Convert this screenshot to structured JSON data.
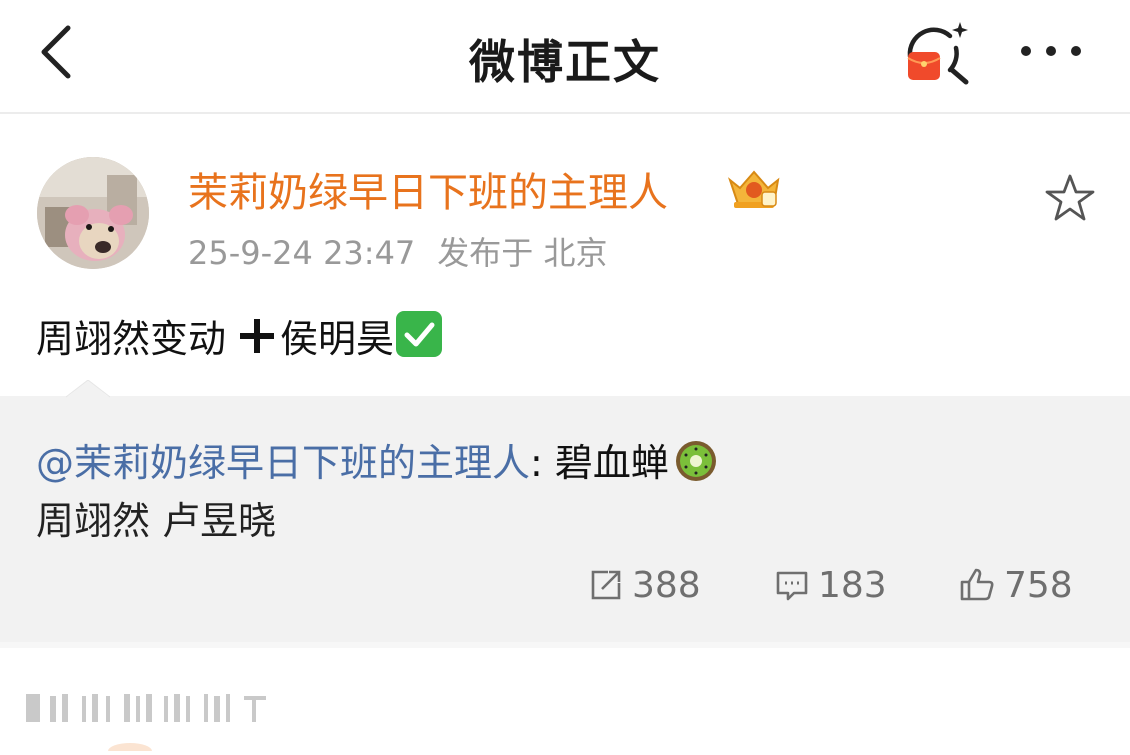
{
  "header": {
    "title": "微博正文",
    "back_icon": "chevron-left-icon",
    "red_packet_icon": "red-packet-search-icon",
    "more_icon": "more-dots-icon"
  },
  "post": {
    "author": "茉莉奶绿早日下班的主理人",
    "author_color": "#e8731d",
    "badge_icon": "crown-badge-icon",
    "timestamp": "25-9-24 23:47",
    "location": "发布于 北京",
    "text_before": "周翊然变动",
    "text_after": "侯明昊"
  },
  "repost": {
    "user": "@茉莉奶绿早日下班的主理人",
    "colon_text": ": 碧血蝉",
    "line2": "周翊然 卢昱晓",
    "user_color": "#4a6ea6",
    "stats": {
      "reposts": "388",
      "comments": "183",
      "likes": "758"
    }
  }
}
